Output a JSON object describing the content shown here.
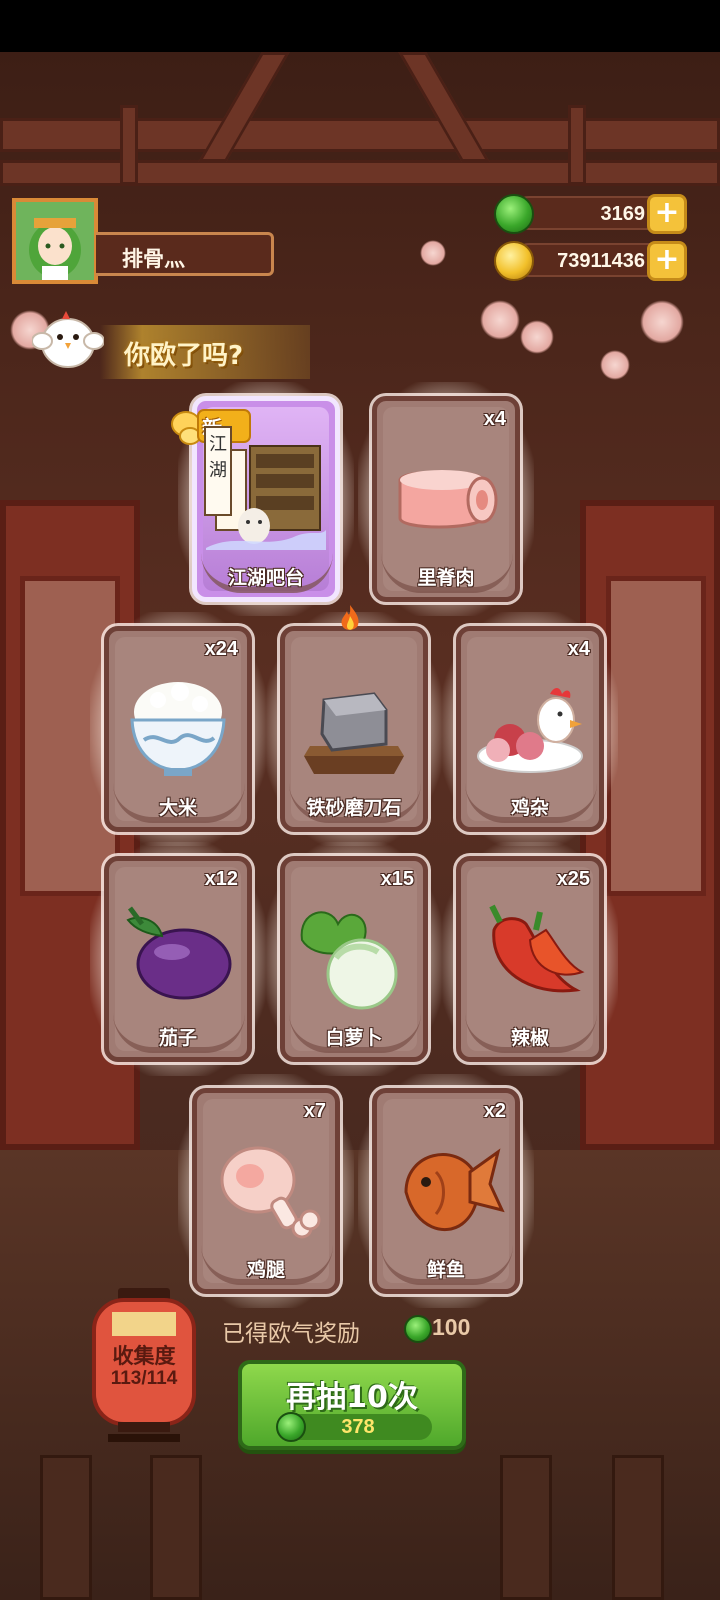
{
  "player": {
    "name": "排骨灬"
  },
  "currencies": {
    "jade": {
      "value": "3169",
      "icon": "jade-icon"
    },
    "coins": {
      "value": "73911436",
      "icon": "coin-icon"
    }
  },
  "slogan": "你欧了吗?",
  "new_badge": "新",
  "cards": [
    {
      "name": "江湖吧台",
      "qty": "",
      "new": true,
      "special": true,
      "icon": "bar-counter-icon"
    },
    {
      "name": "里脊肉",
      "qty": "x4",
      "icon": "pork-loin-icon"
    },
    {
      "name": "大米",
      "qty": "x24",
      "icon": "rice-bowl-icon"
    },
    {
      "name": "铁砂磨刀石",
      "qty": "",
      "icon": "whetstone-icon",
      "fire": true
    },
    {
      "name": "鸡杂",
      "qty": "x4",
      "icon": "chicken-offal-icon"
    },
    {
      "name": "茄子",
      "qty": "x12",
      "icon": "eggplant-icon"
    },
    {
      "name": "白萝卜",
      "qty": "x15",
      "icon": "white-radish-icon"
    },
    {
      "name": "辣椒",
      "qty": "x25",
      "icon": "chili-icon"
    },
    {
      "name": "鸡腿",
      "qty": "x7",
      "icon": "drumstick-icon"
    },
    {
      "name": "鲜鱼",
      "qty": "x2",
      "icon": "fish-icon"
    }
  ],
  "collection": {
    "label": "收集度",
    "count": "113/114"
  },
  "reward": {
    "label": "已得欧气奖励",
    "value": "100"
  },
  "draw_button": {
    "label": "再抽10次",
    "cost": "378"
  },
  "scroll_text": {
    "line1": "江",
    "line2": "湖"
  }
}
